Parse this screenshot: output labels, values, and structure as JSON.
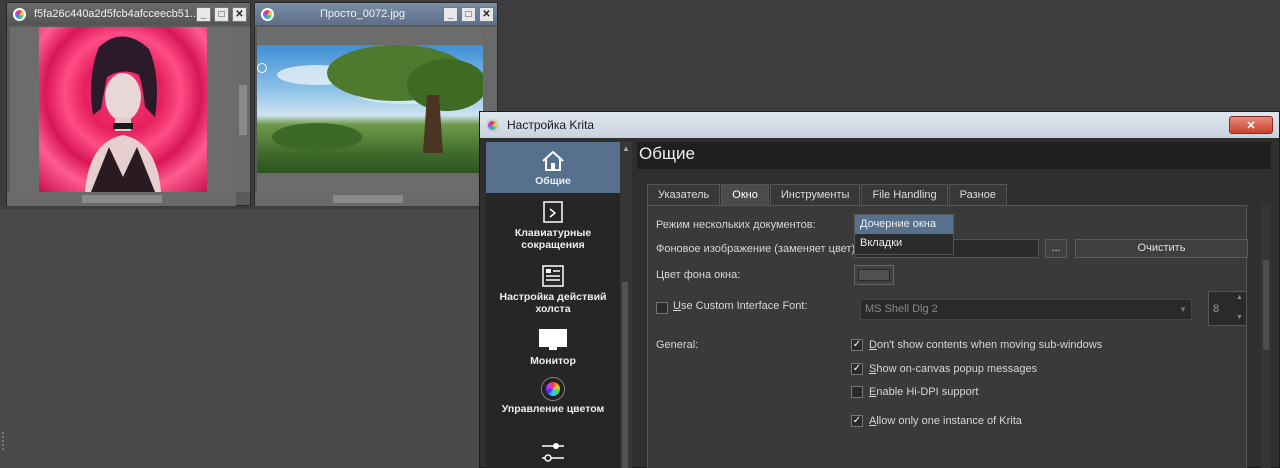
{
  "subwindows": [
    {
      "title": "f5fa26c440a2d5fcb4afcceecb51...",
      "buttons": [
        "_",
        "□",
        "✕"
      ]
    },
    {
      "title": "Просто_0072.jpg",
      "buttons": [
        "_",
        "□",
        "✕"
      ]
    }
  ],
  "dialog": {
    "title": "Настройка Krita",
    "close": "✕",
    "sidebar": [
      {
        "label": "Общие",
        "icon": "home-icon"
      },
      {
        "label": "Клавиатурные сокращения",
        "icon": "shortcut-icon"
      },
      {
        "label": "Настройка действий холста",
        "icon": "canvas-input-icon"
      },
      {
        "label": "Монитор",
        "icon": "monitor-icon"
      },
      {
        "label": "Управление цветом",
        "icon": "color-wheel-icon"
      },
      {
        "label": "",
        "icon": "sliders-icon"
      }
    ],
    "page_title": "Общие",
    "tabs": [
      "Указатель",
      "Окно",
      "Инструменты",
      "File Handling",
      "Разное"
    ],
    "form": {
      "mdi_label": "Режим нескольких документов:",
      "mdi_options": [
        "Дочерние окна",
        "Вкладки"
      ],
      "bg_image_label": "Фоновое изображение (заменяет цвет):",
      "browse": "...",
      "clear": "Очистить",
      "window_bg_label": "Цвет фона окна:",
      "custom_font_label": "Use Custom Interface Font:",
      "custom_font_mnemonic": "U",
      "custom_font_rest": "se Custom Interface Font:",
      "font_value": "MS Shell Dlg 2",
      "font_size": "8",
      "general_label": "General:",
      "options": [
        {
          "mn": "D",
          "rest": "on't show contents when moving sub-windows",
          "checked": true
        },
        {
          "mn": "S",
          "rest": "how on-canvas popup messages",
          "checked": true
        },
        {
          "mn": "E",
          "rest": "nable Hi-DPI support",
          "checked": false
        },
        {
          "mn": "A",
          "rest": "llow only one instance of Krita",
          "checked": true
        }
      ]
    }
  },
  "check_mark": "✓"
}
